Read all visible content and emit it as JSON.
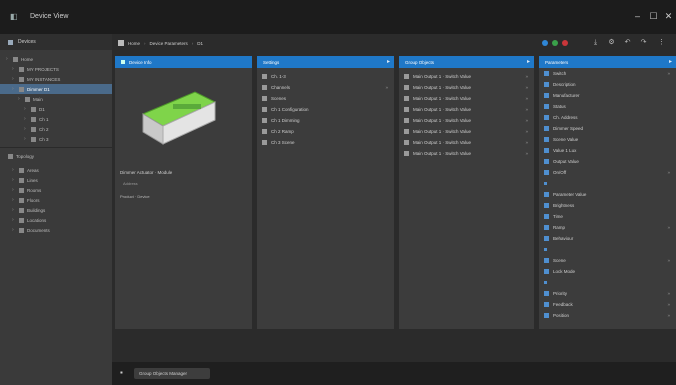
{
  "window": {
    "title": "Device View",
    "controls": [
      "‒",
      "☐",
      "✕"
    ]
  },
  "leftbar": {
    "header": "Devices",
    "tree": [
      {
        "label": "Home",
        "selected": true,
        "indent": 0
      },
      {
        "label": "MY PROJECTS",
        "selected": false,
        "indent": 1
      },
      {
        "label": "MY INSTANCES",
        "selected": false,
        "indent": 1
      },
      {
        "label": "Dimmer D1",
        "selected": true,
        "indent": 1
      },
      {
        "label": "Main",
        "selected": false,
        "indent": 2
      },
      {
        "label": "D1",
        "selected": false,
        "indent": 3
      },
      {
        "label": "Ch 1",
        "selected": false,
        "indent": 3
      },
      {
        "label": "Ch 2",
        "selected": false,
        "indent": 3
      },
      {
        "label": "Ch 3",
        "selected": false,
        "indent": 3
      }
    ],
    "section2_header": "Topology",
    "tree2": [
      {
        "label": "Areas",
        "indent": 1
      },
      {
        "label": "Lines",
        "indent": 1
      },
      {
        "label": "Rooms",
        "indent": 1
      },
      {
        "label": "Floors",
        "indent": 1
      },
      {
        "label": "Buildings",
        "indent": 1
      },
      {
        "label": "Locations",
        "indent": 1
      },
      {
        "label": "Documents",
        "indent": 1
      }
    ]
  },
  "toolbar": {
    "crumbs": [
      "Home",
      "Device Parameters",
      "D1"
    ],
    "dots": [
      "#2f86d6",
      "#3aa04a",
      "#c9363a"
    ]
  },
  "panels": [
    {
      "header": "Device Info",
      "device_caption": "Dimmer Actuator · Module",
      "lines": [
        "Address",
        "Version"
      ],
      "footer": "Product · Device"
    },
    {
      "header": "Settings",
      "rows": [
        {
          "label": "Ch. 1-3",
          "right": ""
        },
        {
          "label": "Channels",
          "right": "»"
        },
        {
          "label": "Scenes",
          "right": ""
        },
        {
          "label": "Ch 1 Configuration",
          "right": ""
        },
        {
          "label": "Ch 1 Dimming",
          "right": ""
        },
        {
          "label": "Ch 2 Ramp",
          "right": ""
        },
        {
          "label": "Ch 3 Scene",
          "right": ""
        }
      ]
    },
    {
      "header": "Group Objects",
      "rows": [
        {
          "label": "Main Output 1 · Switch Value",
          "right": "»"
        },
        {
          "label": "Main Output 1 · Switch Value",
          "right": "»"
        },
        {
          "label": "Main Output 1 · Switch Value",
          "right": "»"
        },
        {
          "label": "Main Output 1 · Switch Value",
          "right": "»"
        },
        {
          "label": "Main Output 1 · Switch Value",
          "right": "»"
        },
        {
          "label": "Main Output 1 · Switch Value",
          "right": "»"
        },
        {
          "label": "Main Output 1 · Switch Value",
          "right": "»"
        },
        {
          "label": "Main Output 1 · Switch Value",
          "right": "»"
        }
      ]
    },
    {
      "header": "Parameters",
      "rows": [
        {
          "label": "Switch",
          "right": "»"
        },
        {
          "label": "Description",
          "right": ""
        },
        {
          "label": "Manufacturer",
          "right": ""
        },
        {
          "label": "Status",
          "right": ""
        },
        {
          "label": "Ch. Address",
          "right": ""
        },
        {
          "label": "Dimmer Speed",
          "right": ""
        },
        {
          "label": "Scene Value",
          "right": ""
        },
        {
          "label": "Value 1 Lux",
          "right": ""
        },
        {
          "label": "Output Value",
          "right": ""
        },
        {
          "label": "On/Off",
          "right": "»"
        },
        {
          "label": "",
          "right": ""
        },
        {
          "label": "Parameter Value",
          "right": ""
        },
        {
          "label": "Brightness",
          "right": ""
        },
        {
          "label": "Time",
          "right": ""
        },
        {
          "label": "Ramp",
          "right": "»"
        },
        {
          "label": "Behaviour",
          "right": ""
        },
        {
          "label": "",
          "right": ""
        },
        {
          "label": "Scene",
          "right": "»"
        },
        {
          "label": "Lock Mode",
          "right": ""
        },
        {
          "label": "",
          "right": ""
        },
        {
          "label": "Priority",
          "right": "»"
        },
        {
          "label": "Feedback",
          "right": "»"
        },
        {
          "label": "Position",
          "right": "»"
        }
      ]
    }
  ],
  "bottom": {
    "tab_label": "Group Objects Manager"
  }
}
